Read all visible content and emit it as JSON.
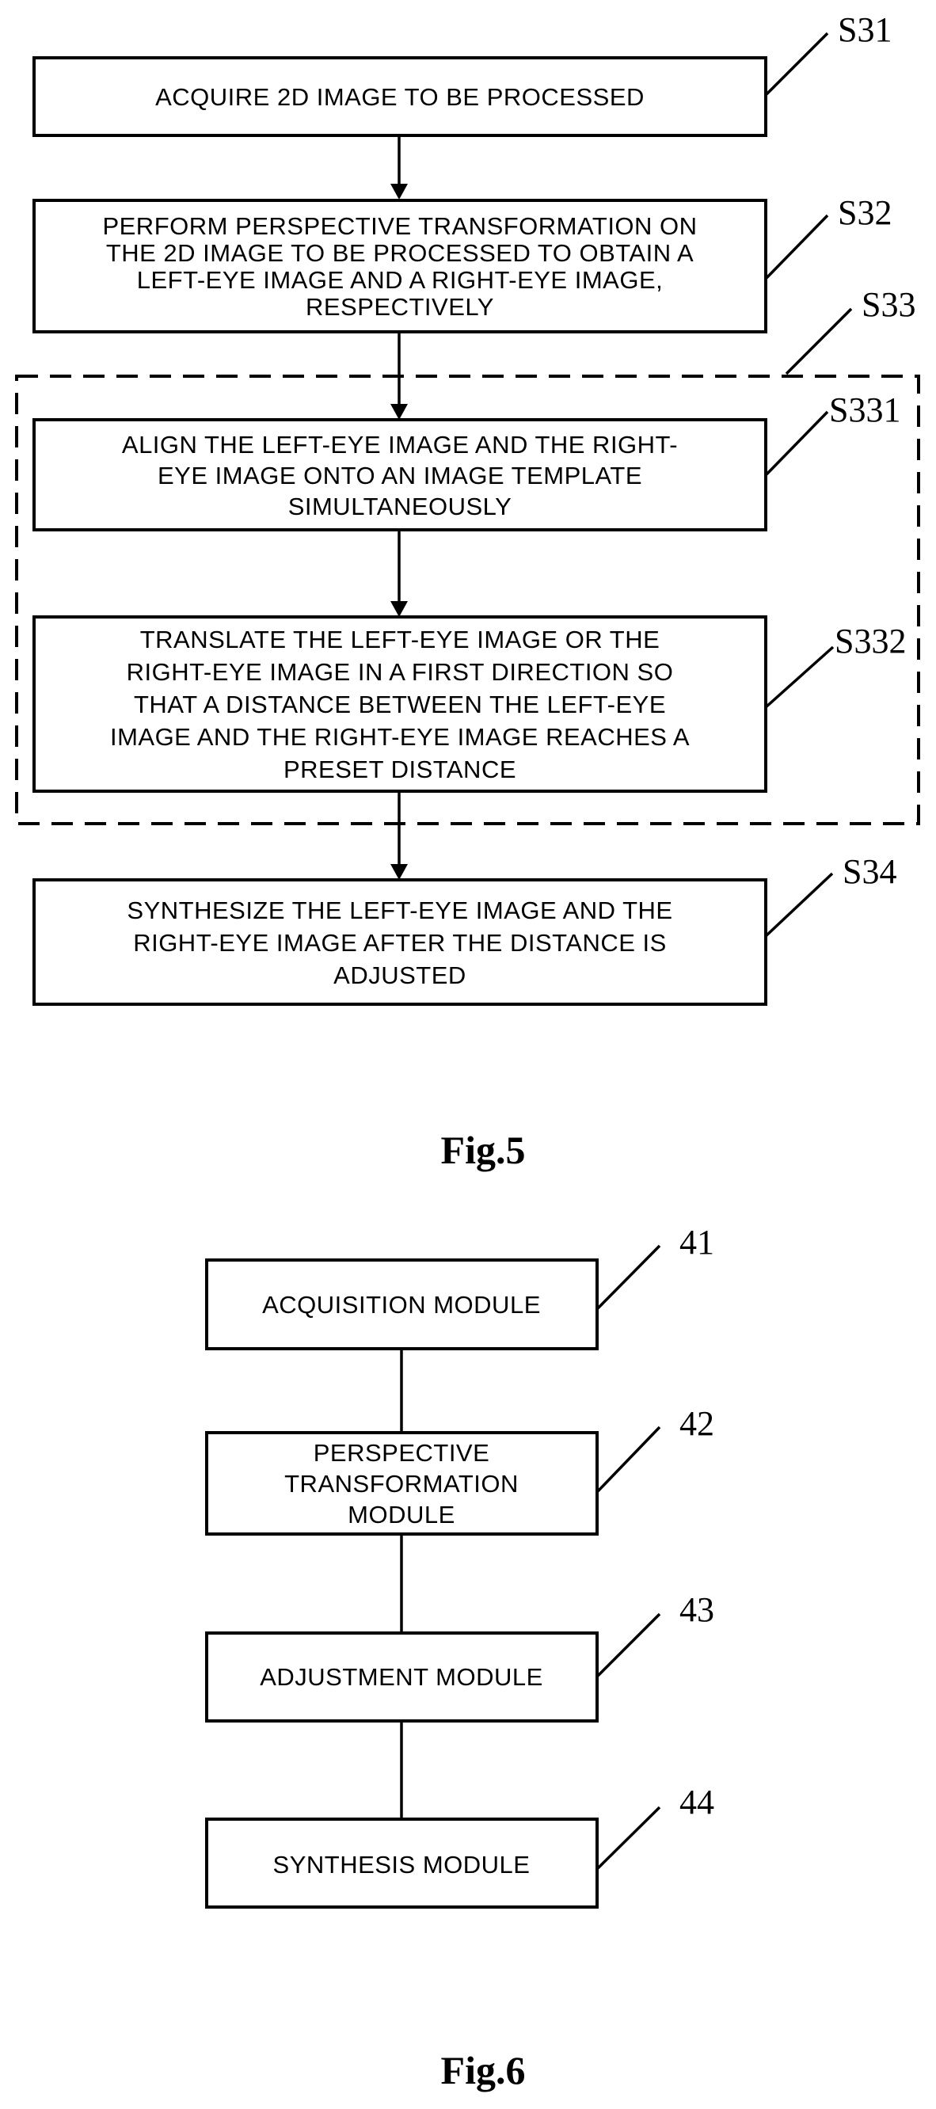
{
  "figure5": {
    "caption": "Fig.5",
    "steps": [
      {
        "id": "S31",
        "label": "S31",
        "lines": [
          "ACQUIRE 2D IMAGE TO BE PROCESSED"
        ]
      },
      {
        "id": "S32",
        "label": "S32",
        "lines": [
          "PERFORM PERSPECTIVE TRANSFORMATION ON",
          "THE 2D IMAGE TO BE PROCESSED TO OBTAIN A",
          "LEFT-EYE IMAGE AND A RIGHT-EYE IMAGE,",
          "RESPECTIVELY"
        ]
      },
      {
        "id": "S331",
        "label": "S331",
        "lines": [
          "ALIGN THE LEFT-EYE IMAGE AND THE RIGHT-",
          "EYE IMAGE ONTO AN IMAGE TEMPLATE",
          "SIMULTANEOUSLY"
        ]
      },
      {
        "id": "S332",
        "label": "S332",
        "lines": [
          "TRANSLATE THE LEFT-EYE IMAGE OR THE",
          "RIGHT-EYE IMAGE IN A FIRST DIRECTION SO",
          "THAT A DISTANCE BETWEEN THE LEFT-EYE",
          "IMAGE AND THE RIGHT-EYE IMAGE REACHES A",
          "PRESET DISTANCE"
        ]
      },
      {
        "id": "S34",
        "label": "S34",
        "lines": [
          "SYNTHESIZE THE LEFT-EYE IMAGE AND THE",
          "RIGHT-EYE IMAGE AFTER THE DISTANCE IS",
          "ADJUSTED"
        ]
      }
    ],
    "group": {
      "id": "S33",
      "label": "S33",
      "contains": [
        "S331",
        "S332"
      ]
    }
  },
  "figure6": {
    "caption": "Fig.6",
    "modules": [
      {
        "id": "41",
        "label": "41",
        "lines": [
          "ACQUISITION MODULE"
        ]
      },
      {
        "id": "42",
        "label": "42",
        "lines": [
          "PERSPECTIVE",
          "TRANSFORMATION",
          "MODULE"
        ]
      },
      {
        "id": "43",
        "label": "43",
        "lines": [
          "ADJUSTMENT MODULE"
        ]
      },
      {
        "id": "44",
        "label": "44",
        "lines": [
          "SYNTHESIS MODULE"
        ]
      }
    ]
  }
}
